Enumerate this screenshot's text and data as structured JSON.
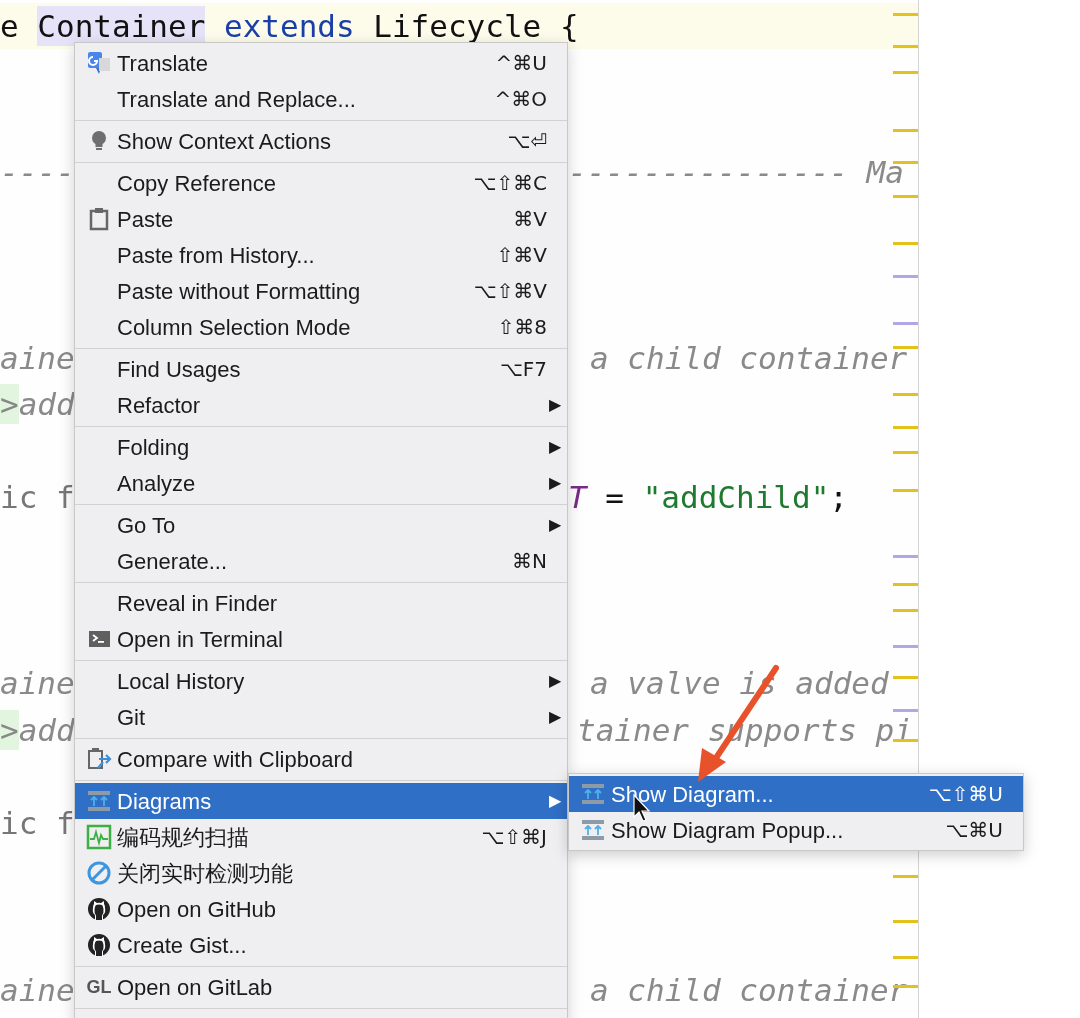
{
  "editor": {
    "current_line": {
      "segments": [
        {
          "text": "e ",
          "kind": "plain"
        },
        {
          "text": "Container",
          "kind": "highlight"
        },
        {
          "text": " extends ",
          "kind": "keyword"
        },
        {
          "text": "Lifecycle {",
          "kind": "plain"
        }
      ]
    },
    "lines": [
      {
        "left": [
          {
            "text": "----",
            "kind": "comment"
          }
        ],
        "right": [
          {
            "text": "--------------- Ma",
            "kind": "comment"
          }
        ]
      },
      {
        "left": [
          {
            "text": "aine",
            "kind": "comment"
          }
        ],
        "right": [
          {
            "text": "a child container",
            "kind": "comment"
          }
        ]
      },
      {
        "left": [
          {
            "text": ">",
            "kind": "tag"
          },
          {
            "text": "add",
            "kind": "comment"
          }
        ]
      },
      {
        "left": [
          {
            "text": "ic f",
            "kind": "dim"
          }
        ],
        "right": [
          {
            "text": "T",
            "kind": "constant"
          },
          {
            "text": " = ",
            "kind": "plain"
          },
          {
            "text": "\"addChild\"",
            "kind": "string"
          },
          {
            "text": ";",
            "kind": "plain"
          }
        ]
      },
      {
        "left": [
          {
            "text": "aine",
            "kind": "comment"
          }
        ],
        "right": [
          {
            "text": "a valve is added",
            "kind": "comment"
          }
        ]
      },
      {
        "left": [
          {
            "text": ">",
            "kind": "tag"
          },
          {
            "text": "add",
            "kind": "comment"
          }
        ],
        "right": [
          {
            "text": "tainer supports pi",
            "kind": "comment"
          }
        ]
      },
      {
        "left": [
          {
            "text": "ic f",
            "kind": "dim"
          }
        ]
      },
      {
        "left": [
          {
            "text": "aine",
            "kind": "comment"
          }
        ],
        "right": [
          {
            "text": "a child container",
            "kind": "comment"
          }
        ]
      }
    ]
  },
  "context_menu": {
    "items": [
      {
        "kind": "item",
        "label": "Translate",
        "shortcut": "^⌘U",
        "selected": false
      },
      {
        "kind": "item",
        "label": "Translate and Replace...",
        "shortcut": "^⌘O",
        "selected": false
      },
      {
        "kind": "separator"
      },
      {
        "kind": "item",
        "label": "Show Context Actions",
        "shortcut": "⌥⏎",
        "selected": false
      },
      {
        "kind": "separator"
      },
      {
        "kind": "item",
        "label": "Copy Reference",
        "shortcut": "⌥⇧⌘C",
        "selected": false
      },
      {
        "kind": "item",
        "label": "Paste",
        "shortcut": "⌘V",
        "selected": false
      },
      {
        "kind": "item",
        "label": "Paste from History...",
        "shortcut": "⇧⌘V",
        "selected": false
      },
      {
        "kind": "item",
        "label": "Paste without Formatting",
        "shortcut": "⌥⇧⌘V",
        "selected": false
      },
      {
        "kind": "item",
        "label": "Column Selection Mode",
        "shortcut": "⇧⌘8",
        "selected": false
      },
      {
        "kind": "separator"
      },
      {
        "kind": "item",
        "label": "Find Usages",
        "shortcut": "⌥F7",
        "selected": false
      },
      {
        "kind": "item",
        "label": "Refactor",
        "submenu_arrow": "▶",
        "selected": false
      },
      {
        "kind": "separator"
      },
      {
        "kind": "item",
        "label": "Folding",
        "submenu_arrow": "▶",
        "selected": false
      },
      {
        "kind": "item",
        "label": "Analyze",
        "submenu_arrow": "▶",
        "selected": false
      },
      {
        "kind": "separator"
      },
      {
        "kind": "item",
        "label": "Go To",
        "submenu_arrow": "▶",
        "selected": false
      },
      {
        "kind": "item",
        "label": "Generate...",
        "shortcut": "⌘N",
        "selected": false
      },
      {
        "kind": "separator"
      },
      {
        "kind": "item",
        "label": "Reveal in Finder",
        "selected": false
      },
      {
        "kind": "item",
        "label": "Open in Terminal",
        "selected": false
      },
      {
        "kind": "separator"
      },
      {
        "kind": "item",
        "label": "Local History",
        "submenu_arrow": "▶",
        "selected": false
      },
      {
        "kind": "item",
        "label": "Git",
        "submenu_arrow": "▶",
        "selected": false
      },
      {
        "kind": "separator"
      },
      {
        "kind": "item",
        "label": "Compare with Clipboard",
        "selected": false
      },
      {
        "kind": "separator"
      },
      {
        "kind": "item",
        "label": "Diagrams",
        "submenu_arrow": "▶",
        "selected": true
      },
      {
        "kind": "item",
        "label": "编码规约扫描",
        "shortcut": "⌥⇧⌘J",
        "selected": false
      },
      {
        "kind": "item",
        "label": "关闭实时检测功能",
        "selected": false
      },
      {
        "kind": "item",
        "label": "Open on GitHub",
        "selected": false
      },
      {
        "kind": "item",
        "label": "Create Gist...",
        "selected": false
      },
      {
        "kind": "separator"
      },
      {
        "kind": "item",
        "icon_text": "GL",
        "label": "Open on GitLab",
        "selected": false
      },
      {
        "kind": "separator"
      }
    ]
  },
  "submenu": {
    "items": [
      {
        "kind": "item",
        "label": "Show Diagram...",
        "shortcut": "⌥⇧⌘U",
        "selected": true
      },
      {
        "kind": "item",
        "label": "Show Diagram Popup...",
        "shortcut": "⌥⌘U",
        "selected": false
      }
    ]
  }
}
